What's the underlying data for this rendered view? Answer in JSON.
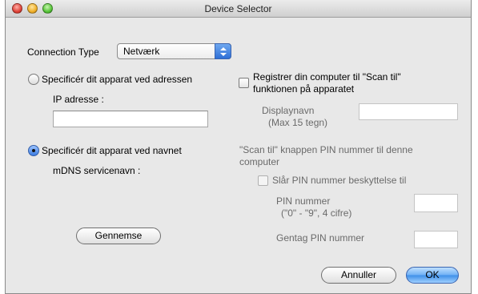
{
  "window": {
    "title": "Device Selector"
  },
  "connection": {
    "label": "Connection Type",
    "selected": "Netværk"
  },
  "left": {
    "by_address_label": "Specificér dit apparat ved adressen",
    "by_address_selected": false,
    "ip_label": "IP adresse :",
    "ip_value": "",
    "by_name_label": "Specificér dit apparat ved navnet",
    "by_name_selected": true,
    "mdns_label": "mDNS servicenavn :",
    "browse_button": "Gennemse"
  },
  "right": {
    "register_line1": "Registrer din computer til \"Scan til\"",
    "register_line2": "funktionen på apparatet",
    "register_checked": false,
    "display_name_line1": "Displaynavn",
    "display_name_line2": "(Max 15 tegn)",
    "display_name_value": "",
    "pin_info_line1": "\"Scan til\" knappen PIN nummer til denne",
    "pin_info_line2": "computer",
    "pin_protect_label": "Slår PIN nummer beskyttelse til",
    "pin_protect_checked": false,
    "pin_label_line1": "PIN nummer",
    "pin_label_line2": "(\"0\" - \"9\", 4 cifre)",
    "pin_value": "",
    "repeat_pin_label": "Gentag PIN nummer",
    "repeat_pin_value": ""
  },
  "footer": {
    "cancel_button": "Annuller",
    "ok_button": "OK"
  },
  "icons": {
    "close": "close-traffic-light-icon",
    "minimize": "minimize-traffic-light-icon",
    "zoom": "zoom-traffic-light-icon",
    "popup_arrows": "popup-arrows-icon"
  },
  "colors": {
    "accent": "#3d8ee8",
    "window_bg": "#e8e8e8",
    "disabled_text": "#6a6a6a"
  }
}
